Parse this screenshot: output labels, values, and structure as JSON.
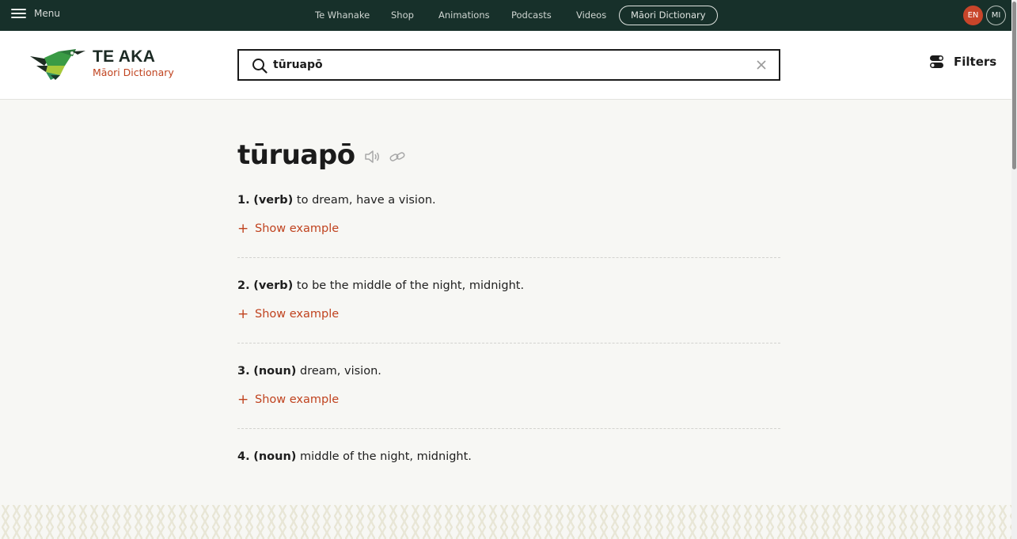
{
  "topbar": {
    "menu_label": "Menu",
    "nav": [
      "Te Whanake",
      "Shop",
      "Animations",
      "Podcasts",
      "Videos",
      "Māori Dictionary"
    ],
    "lang_en": "EN",
    "lang_mi": "MI"
  },
  "header": {
    "logo_title": "TE AKA",
    "logo_subtitle": "Māori Dictionary",
    "search_value": "tūruapō",
    "filters_label": "Filters"
  },
  "entry": {
    "headword": "tūruapō",
    "show_example_label": "Show example",
    "senses": [
      {
        "num": "1.",
        "pos": "(verb)",
        "def": "to dream, have a vision."
      },
      {
        "num": "2.",
        "pos": "(verb)",
        "def": "to be the middle of the night, midnight."
      },
      {
        "num": "3.",
        "pos": "(noun)",
        "def": "dream, vision."
      },
      {
        "num": "4.",
        "pos": "(noun)",
        "def": "middle of the night, midnight."
      }
    ]
  },
  "colors": {
    "topbar_bg": "#17302a",
    "accent": "#c0431f",
    "page_bg": "#f7f7f4"
  },
  "icons": [
    "menu-icon",
    "search-icon",
    "close-icon",
    "filters-icon",
    "speaker-icon",
    "link-icon",
    "logo-bird-icon"
  ]
}
